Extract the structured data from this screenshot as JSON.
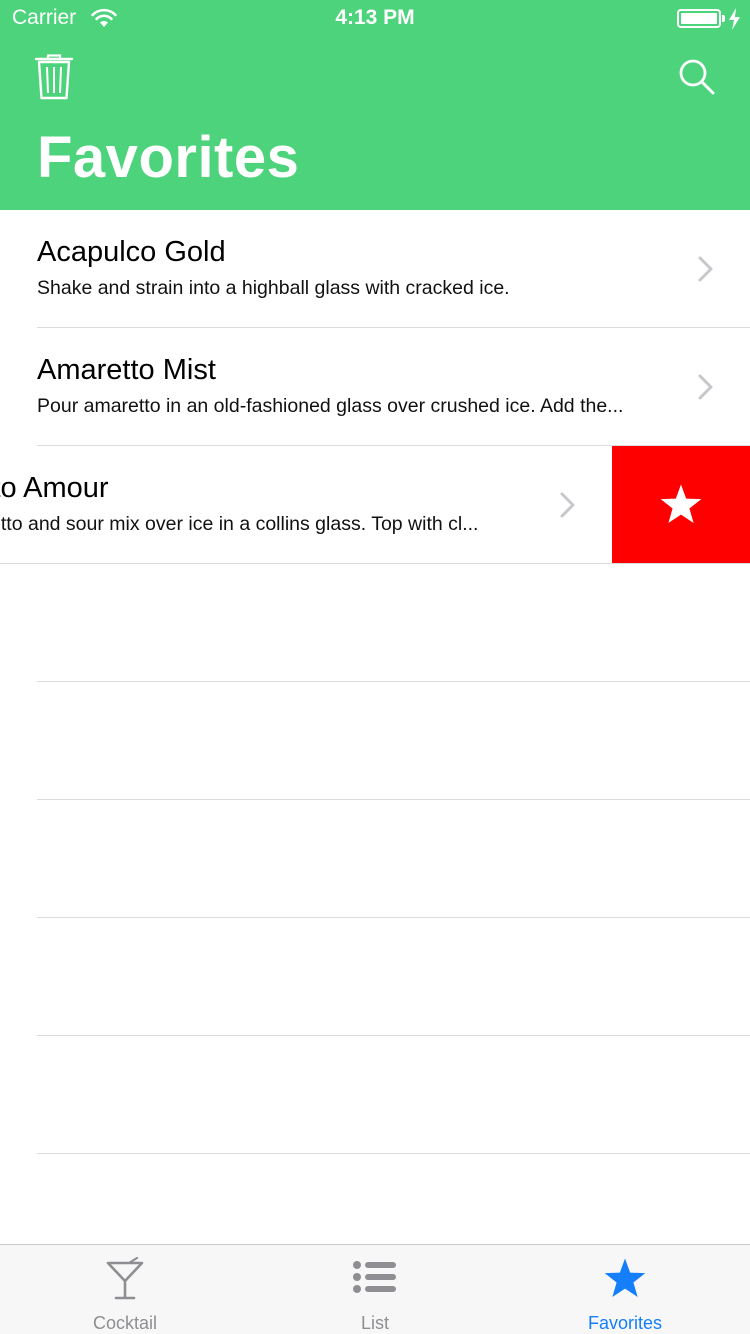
{
  "status_bar": {
    "carrier": "Carrier",
    "time": "4:13 PM"
  },
  "header": {
    "title": "Favorites",
    "left_icon": "trash-icon",
    "right_icon": "search-icon",
    "background_color": "#4cd37b"
  },
  "list": {
    "items": [
      {
        "title": "Acapulco Gold",
        "subtitle": "Shake and strain into a highball glass with cracked ice."
      },
      {
        "title": "Amaretto Mist",
        "subtitle": "Pour amaretto in an old-fashioned glass over crushed ice. Add the..."
      },
      {
        "title": "Amaretto Amour",
        "subtitle": "Pour amaretto and sour mix over ice in a collins glass. Top with cl...",
        "swipe_action": {
          "icon": "star-icon",
          "color": "#ff0000"
        }
      }
    ]
  },
  "tabbar": {
    "tabs": [
      {
        "label": "Cocktail",
        "icon": "cocktail-glass-icon",
        "active": false
      },
      {
        "label": "List",
        "icon": "list-icon",
        "active": false
      },
      {
        "label": "Favorites",
        "icon": "star-icon",
        "active": true
      }
    ],
    "active_color": "#147efb",
    "inactive_color": "#8e8e93"
  }
}
